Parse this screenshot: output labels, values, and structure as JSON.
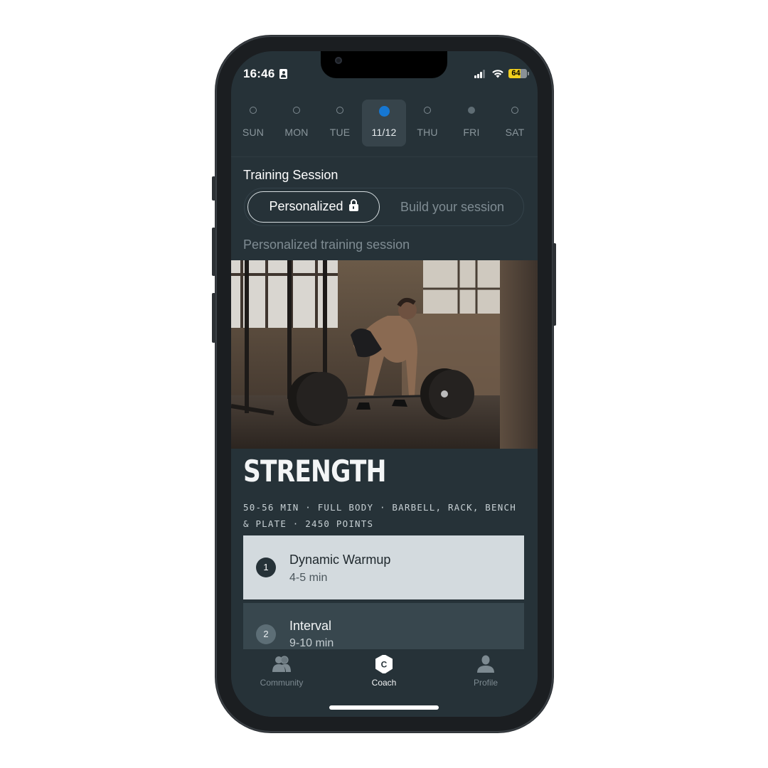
{
  "status_bar": {
    "time": "16:46",
    "battery_percent": "64",
    "battery_level": 0.64
  },
  "week": {
    "days": [
      {
        "label": "SUN",
        "state": "empty"
      },
      {
        "label": "MON",
        "state": "empty"
      },
      {
        "label": "TUE",
        "state": "empty"
      },
      {
        "label": "11/12",
        "state": "active",
        "selected": true
      },
      {
        "label": "THU",
        "state": "empty"
      },
      {
        "label": "FRI",
        "state": "filled"
      },
      {
        "label": "SAT",
        "state": "empty"
      }
    ],
    "active_dot_color": "#1677d2"
  },
  "session": {
    "title": "Training Session",
    "toggle": {
      "active_label": "Personalized",
      "inactive_label": "Build your session"
    },
    "subtitle": "Personalized training session"
  },
  "workout": {
    "title": "STRENGTH",
    "meta": "50-56 MIN · FULL BODY · BARBELL, RACK, BENCH & PLATE · 2450 POINTS",
    "image_alt": "Man performing barbell deadlift in industrial gym"
  },
  "blocks": [
    {
      "number": "1",
      "title": "Dynamic Warmup",
      "duration": "4-5 min"
    },
    {
      "number": "2",
      "title": "Interval",
      "duration": "9-10 min"
    }
  ],
  "tabbar": {
    "tabs": [
      {
        "label": "Community",
        "icon": "community-icon"
      },
      {
        "label": "Coach",
        "icon": "coach-icon",
        "active": true
      },
      {
        "label": "Profile",
        "icon": "profile-icon"
      }
    ]
  },
  "colors": {
    "background": "#263238",
    "card_active": "#d3dade",
    "card_inactive": "#38474e",
    "battery": "#f2cf1d"
  }
}
